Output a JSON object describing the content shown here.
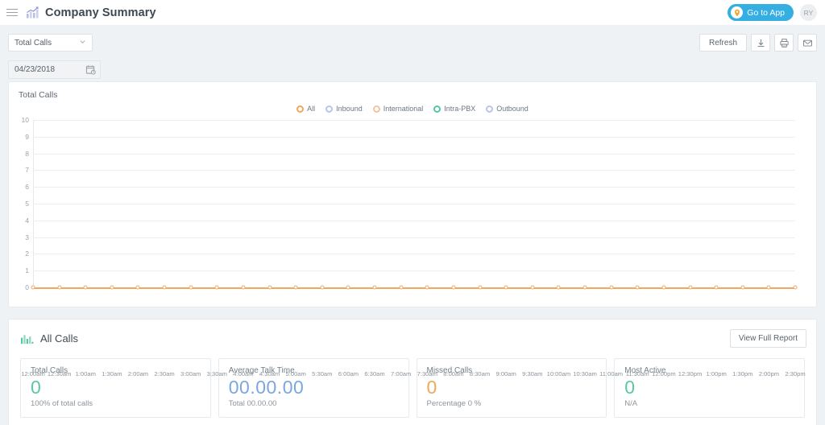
{
  "header": {
    "menu_icon": "hamburger-icon",
    "logo_icon": "bar-chart-logo-icon",
    "title": "Company Summary",
    "goto_app_label": "Go to App",
    "goto_app_icon": "location-pin-icon",
    "avatar_initials": "RY"
  },
  "toolbar": {
    "report_select_value": "Total Calls",
    "date_value": "04/23/2018",
    "calendar_icon": "calendar-icon",
    "refresh_label": "Refresh",
    "download_icon": "download-icon",
    "print_icon": "print-icon",
    "mail_icon": "mail-icon"
  },
  "chart_panel": {
    "title": "Total Calls"
  },
  "all_calls": {
    "icon": "bar-chart-icon",
    "title": "All Calls",
    "view_report_label": "View Full Report",
    "cards": [
      {
        "label": "Total Calls",
        "value": "0",
        "sub": "100% of total calls",
        "color": "#5bc8a4"
      },
      {
        "label": "Average Talk Time",
        "value": "00.00.00",
        "sub": "Total 00.00.00",
        "color": "#7ba7e0"
      },
      {
        "label": "Missed Calls",
        "value": "0",
        "sub": "Percentage 0 %",
        "color": "#eda95c"
      },
      {
        "label": "Most Active",
        "value": "0",
        "sub": "N/A",
        "color": "#5bc8a4"
      }
    ]
  },
  "colors": {
    "accent_blue": "#35aee2",
    "series_orange": "#f0a860",
    "page_bg": "#eef2f5"
  },
  "chart_data": {
    "type": "line",
    "title": "Total Calls",
    "xlabel": "",
    "ylabel": "",
    "ylim": [
      0,
      10
    ],
    "yticks": [
      0,
      1,
      2,
      3,
      4,
      5,
      6,
      7,
      8,
      9,
      10
    ],
    "grid": true,
    "legend_position": "top-center",
    "legend": [
      {
        "name": "All",
        "color": "#f0a860"
      },
      {
        "name": "Inbound",
        "color": "#b9c4e8"
      },
      {
        "name": "International",
        "color": "#f3c3a4"
      },
      {
        "name": "Intra-PBX",
        "color": "#56c4a7"
      },
      {
        "name": "Outbound",
        "color": "#bcc4e6"
      }
    ],
    "categories": [
      "12:00am",
      "12:30am",
      "1:00am",
      "1:30am",
      "2:00am",
      "2:30am",
      "3:00am",
      "3:30am",
      "4:00am",
      "4:30am",
      "5:00am",
      "5:30am",
      "6:00am",
      "6:30am",
      "7:00am",
      "7:30am",
      "8:00am",
      "8:30am",
      "9:00am",
      "9:30am",
      "10:00am",
      "10:30am",
      "11:00am",
      "11:30am",
      "12:00pm",
      "12:30pm",
      "1:00pm",
      "1:30pm",
      "2:00pm",
      "2:30pm"
    ],
    "series": [
      {
        "name": "All",
        "color": "#f0a860",
        "values": [
          0,
          0,
          0,
          0,
          0,
          0,
          0,
          0,
          0,
          0,
          0,
          0,
          0,
          0,
          0,
          0,
          0,
          0,
          0,
          0,
          0,
          0,
          0,
          0,
          0,
          0,
          0,
          0,
          0,
          0
        ]
      }
    ]
  }
}
